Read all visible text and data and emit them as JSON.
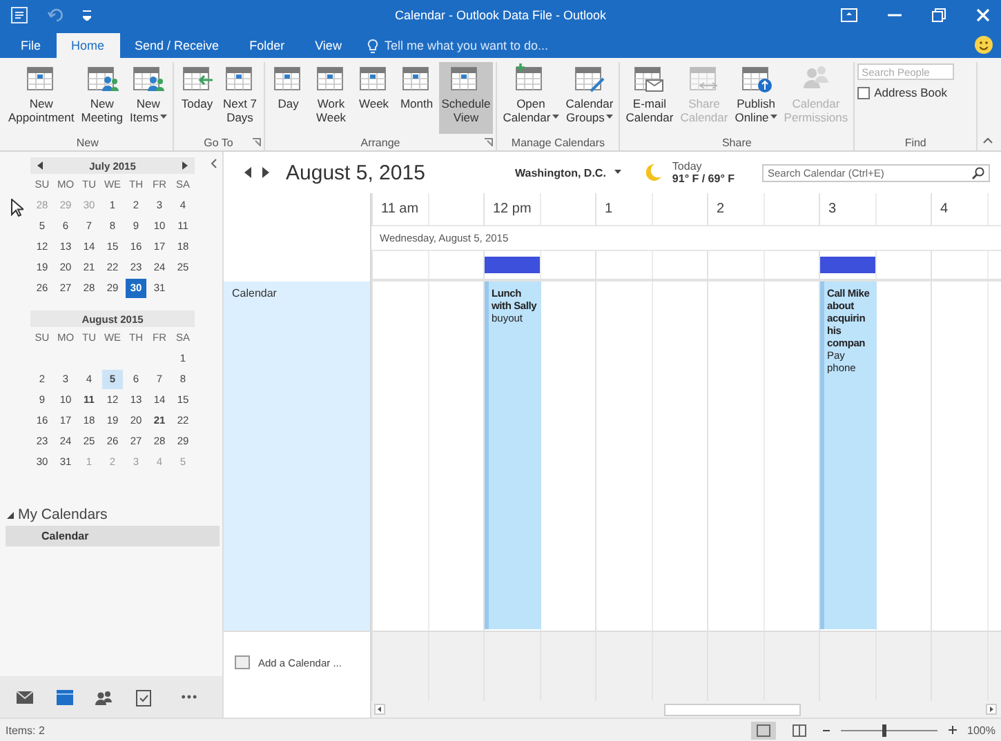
{
  "window": {
    "title": "Calendar - Outlook Data File - Outlook"
  },
  "tabs": [
    {
      "label": "File",
      "selected": false
    },
    {
      "label": "Home",
      "selected": true
    },
    {
      "label": "Send / Receive",
      "selected": false
    },
    {
      "label": "Folder",
      "selected": false
    },
    {
      "label": "View",
      "selected": false
    }
  ],
  "tell_me": {
    "placeholder": "Tell me what you want to do..."
  },
  "ribbon": {
    "groups": [
      {
        "label": "New",
        "launcher": false,
        "buttons": [
          {
            "lines": [
              "New",
              "Appointment"
            ],
            "dropdown": false,
            "disabled": false,
            "selected": false
          },
          {
            "lines": [
              "New",
              "Meeting"
            ],
            "dropdown": false,
            "disabled": false,
            "selected": false
          },
          {
            "lines": [
              "New",
              "Items"
            ],
            "dropdown": true,
            "disabled": false,
            "selected": false
          }
        ]
      },
      {
        "label": "Go To",
        "launcher": true,
        "buttons": [
          {
            "lines": [
              "Today"
            ],
            "dropdown": false,
            "disabled": false,
            "selected": false
          },
          {
            "lines": [
              "Next 7",
              "Days"
            ],
            "dropdown": false,
            "disabled": false,
            "selected": false
          }
        ]
      },
      {
        "label": "Arrange",
        "launcher": true,
        "buttons": [
          {
            "lines": [
              "Day"
            ],
            "dropdown": false,
            "disabled": false,
            "selected": false
          },
          {
            "lines": [
              "Work",
              "Week"
            ],
            "dropdown": false,
            "disabled": false,
            "selected": false
          },
          {
            "lines": [
              "Week"
            ],
            "dropdown": false,
            "disabled": false,
            "selected": false
          },
          {
            "lines": [
              "Month"
            ],
            "dropdown": false,
            "disabled": false,
            "selected": false
          },
          {
            "lines": [
              "Schedule",
              "View"
            ],
            "dropdown": false,
            "disabled": false,
            "selected": true
          }
        ]
      },
      {
        "label": "Manage Calendars",
        "launcher": false,
        "buttons": [
          {
            "lines": [
              "Open",
              "Calendar"
            ],
            "dropdown": true,
            "disabled": false,
            "selected": false
          },
          {
            "lines": [
              "Calendar",
              "Groups"
            ],
            "dropdown": true,
            "disabled": false,
            "selected": false
          }
        ]
      },
      {
        "label": "Share",
        "launcher": false,
        "buttons": [
          {
            "lines": [
              "E-mail",
              "Calendar"
            ],
            "dropdown": false,
            "disabled": false,
            "selected": false
          },
          {
            "lines": [
              "Share",
              "Calendar"
            ],
            "dropdown": false,
            "disabled": true,
            "selected": false
          },
          {
            "lines": [
              "Publish",
              "Online"
            ],
            "dropdown": true,
            "disabled": false,
            "selected": false
          },
          {
            "lines": [
              "Calendar",
              "Permissions"
            ],
            "dropdown": false,
            "disabled": true,
            "selected": false
          }
        ]
      }
    ],
    "find": {
      "label": "Find",
      "search": {
        "placeholder": "Search People"
      },
      "address_book": "Address Book"
    }
  },
  "nav": {
    "months": [
      {
        "title": "July 2015",
        "arrows": true,
        "weekdays": [
          "SU",
          "MO",
          "TU",
          "WE",
          "TH",
          "FR",
          "SA"
        ],
        "weeks": [
          [
            {
              "t": "28",
              "kind": "other",
              "selected": false
            },
            {
              "t": "29",
              "kind": "other",
              "selected": false
            },
            {
              "t": "30",
              "kind": "other",
              "selected": false
            },
            {
              "t": "1",
              "kind": "day",
              "selected": false
            },
            {
              "t": "2",
              "kind": "day",
              "selected": false
            },
            {
              "t": "3",
              "kind": "day",
              "selected": false
            },
            {
              "t": "4",
              "kind": "day",
              "selected": false
            }
          ],
          [
            {
              "t": "5",
              "kind": "day",
              "selected": false
            },
            {
              "t": "6",
              "kind": "day",
              "selected": false
            },
            {
              "t": "7",
              "kind": "day",
              "selected": false
            },
            {
              "t": "8",
              "kind": "day",
              "selected": false
            },
            {
              "t": "9",
              "kind": "day",
              "selected": false
            },
            {
              "t": "10",
              "kind": "day",
              "selected": false
            },
            {
              "t": "11",
              "kind": "day",
              "selected": false
            }
          ],
          [
            {
              "t": "12",
              "kind": "day",
              "selected": false
            },
            {
              "t": "13",
              "kind": "day",
              "selected": false
            },
            {
              "t": "14",
              "kind": "day",
              "selected": false
            },
            {
              "t": "15",
              "kind": "day",
              "selected": false
            },
            {
              "t": "16",
              "kind": "day",
              "selected": false
            },
            {
              "t": "17",
              "kind": "day",
              "selected": false
            },
            {
              "t": "18",
              "kind": "day",
              "selected": false
            }
          ],
          [
            {
              "t": "19",
              "kind": "day",
              "selected": false
            },
            {
              "t": "20",
              "kind": "day",
              "selected": false
            },
            {
              "t": "21",
              "kind": "day",
              "selected": false
            },
            {
              "t": "22",
              "kind": "day",
              "selected": false
            },
            {
              "t": "23",
              "kind": "day",
              "selected": false
            },
            {
              "t": "24",
              "kind": "day",
              "selected": false
            },
            {
              "t": "25",
              "kind": "day",
              "selected": false
            }
          ],
          [
            {
              "t": "26",
              "kind": "day",
              "selected": false
            },
            {
              "t": "27",
              "kind": "day",
              "selected": false
            },
            {
              "t": "28",
              "kind": "day",
              "selected": false
            },
            {
              "t": "29",
              "kind": "day",
              "selected": false
            },
            {
              "t": "30",
              "kind": "today",
              "selected": false
            },
            {
              "t": "31",
              "kind": "day",
              "selected": false
            }
          ]
        ]
      },
      {
        "title": "August 2015",
        "arrows": false,
        "weekdays": [
          "SU",
          "MO",
          "TU",
          "WE",
          "TH",
          "FR",
          "SA"
        ],
        "weeks": [
          [
            {
              "t": "1",
              "kind": "day",
              "selected": false
            }
          ],
          [
            {
              "t": "2",
              "kind": "day",
              "selected": false
            },
            {
              "t": "3",
              "kind": "day",
              "selected": false
            },
            {
              "t": "4",
              "kind": "day",
              "selected": false
            },
            {
              "t": "5",
              "kind": "day",
              "selected": true
            },
            {
              "t": "6",
              "kind": "day",
              "selected": false
            },
            {
              "t": "7",
              "kind": "day",
              "selected": false
            },
            {
              "t": "8",
              "kind": "day",
              "selected": false
            }
          ],
          [
            {
              "t": "9",
              "kind": "day",
              "selected": false
            },
            {
              "t": "10",
              "kind": "day",
              "selected": false
            },
            {
              "t": "11",
              "kind": "busy",
              "selected": false
            },
            {
              "t": "12",
              "kind": "day",
              "selected": false
            },
            {
              "t": "13",
              "kind": "day",
              "selected": false
            },
            {
              "t": "14",
              "kind": "day",
              "selected": false
            },
            {
              "t": "15",
              "kind": "day",
              "selected": false
            }
          ],
          [
            {
              "t": "16",
              "kind": "day",
              "selected": false
            },
            {
              "t": "17",
              "kind": "day",
              "selected": false
            },
            {
              "t": "18",
              "kind": "day",
              "selected": false
            },
            {
              "t": "19",
              "kind": "day",
              "selected": false
            },
            {
              "t": "20",
              "kind": "day",
              "selected": false
            },
            {
              "t": "21",
              "kind": "busy",
              "selected": false
            },
            {
              "t": "22",
              "kind": "day",
              "selected": false
            }
          ],
          [
            {
              "t": "23",
              "kind": "day",
              "selected": false
            },
            {
              "t": "24",
              "kind": "day",
              "selected": false
            },
            {
              "t": "25",
              "kind": "day",
              "selected": false
            },
            {
              "t": "26",
              "kind": "day",
              "selected": false
            },
            {
              "t": "27",
              "kind": "day",
              "selected": false
            },
            {
              "t": "28",
              "kind": "day",
              "selected": false
            },
            {
              "t": "29",
              "kind": "day",
              "selected": false
            }
          ],
          [
            {
              "t": "30",
              "kind": "day",
              "selected": false
            },
            {
              "t": "31",
              "kind": "day",
              "selected": false
            },
            {
              "t": "1",
              "kind": "other",
              "selected": false
            },
            {
              "t": "2",
              "kind": "other",
              "selected": false
            },
            {
              "t": "3",
              "kind": "other",
              "selected": false
            },
            {
              "t": "4",
              "kind": "other",
              "selected": false
            },
            {
              "t": "5",
              "kind": "other",
              "selected": false
            }
          ]
        ]
      }
    ],
    "folders": [
      {
        "label": "My Calendars",
        "expanded": true,
        "children": [
          {
            "label": "Calendar",
            "selected": true
          }
        ]
      }
    ],
    "footer": [
      {
        "selected": false
      },
      {
        "selected": true
      },
      {
        "selected": false
      },
      {
        "selected": false
      }
    ],
    "more": "•••"
  },
  "schedule": {
    "title": "August 5, 2015",
    "weather": {
      "location": "Washington, D.C.",
      "day": "Today",
      "temps": "91° F / 69° F"
    },
    "search": {
      "placeholder": "Search Calendar (Ctrl+E)"
    },
    "date": "Wednesday, August 5, 2015",
    "calendar_label": "Calendar",
    "hours": [
      {
        "label": "11 am"
      },
      {
        "label": "12 pm",
        "events": [
          {
            "title": "Lunch with Sally",
            "location": "buyout"
          }
        ]
      },
      {
        "label": "1"
      },
      {
        "label": "2"
      },
      {
        "label": "3",
        "events": [
          {
            "title": "Call Mike about acquirin his compan",
            "location": "Pay phone"
          }
        ]
      },
      {
        "label": "4"
      }
    ],
    "add_calendar": "Add a Calendar ..."
  },
  "status_bar": {
    "items": "Items: 2",
    "views": [
      {
        "selected": true
      },
      {
        "selected": false
      }
    ],
    "zoom": {
      "level": 0.45,
      "reading": "100%"
    }
  }
}
